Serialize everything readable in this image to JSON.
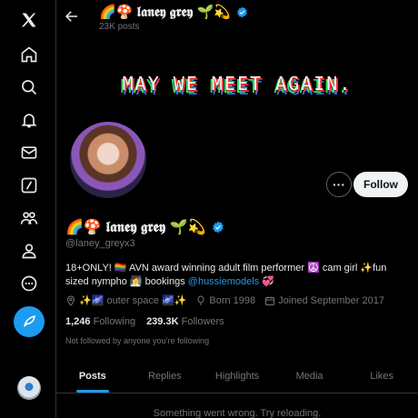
{
  "header": {
    "name": "🌈🍄 𝖑𝖆𝖓𝖊𝖞 𝖌𝖗𝖊𝖞 🌱💫",
    "posts_count": "23K posts"
  },
  "banner": {
    "text": "MAY WE MEET AGAIN."
  },
  "profile": {
    "display_name": "🌈🍄 𝖑𝖆𝖓𝖊𝖞 𝖌𝖗𝖊𝖞 🌱💫",
    "handle": "@laney_greyx3",
    "bio_text": "18+ONLY! 🏳️‍🌈 AVN award winning adult film performer ☮️ cam girl ✨fun sized nympho 🧖‍♀️ bookings ",
    "bio_link": "@hussiemodels",
    "bio_suffix": " 💞",
    "location": "✨🌌 outer space 🌌✨",
    "born": "Born 1998",
    "joined": "Joined September 2017",
    "following_count": "1,246",
    "following_label": "Following",
    "followers_count": "239.3K",
    "followers_label": "Followers",
    "not_followed_text": "Not followed by anyone you’re following"
  },
  "actions": {
    "more_label": "···",
    "follow_label": "Follow"
  },
  "tabs": [
    {
      "label": "Posts",
      "active": true
    },
    {
      "label": "Replies",
      "active": false
    },
    {
      "label": "Highlights",
      "active": false
    },
    {
      "label": "Media",
      "active": false
    },
    {
      "label": "Likes",
      "active": false
    }
  ],
  "feed": {
    "error_text": "Something went wrong. Try reloading."
  },
  "sidebar": {
    "icons": [
      "x-logo-icon",
      "home-icon",
      "search-icon",
      "bell-icon",
      "mail-icon",
      "grok-icon",
      "communities-icon",
      "profile-icon",
      "more-icon",
      "compose-icon",
      "avatar"
    ]
  },
  "colors": {
    "accent": "#1d9bf0",
    "background": "#000000",
    "text": "#e7e9ea",
    "muted": "#71767b",
    "verified": "#1d9bf0"
  }
}
